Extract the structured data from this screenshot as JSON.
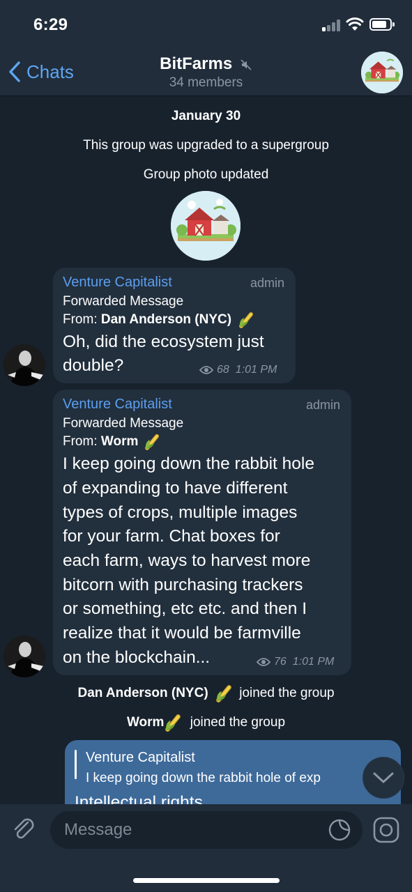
{
  "status_bar": {
    "time": "6:29"
  },
  "header": {
    "back_label": "Chats",
    "title": "BitFarms",
    "subtitle": "34 members"
  },
  "service_messages": {
    "date": "January 30",
    "upgraded": "This group was upgraded to a supergroup",
    "photo_updated": "Group photo updated"
  },
  "messages": [
    {
      "sender": "Venture Capitalist",
      "role": "admin",
      "forward_label": "Forwarded Message",
      "from_prefix": "From: ",
      "from_name": "Dan Anderson (NYC)",
      "lines": [
        "Oh, did the ecosystem just",
        "double?"
      ],
      "views": "68",
      "time": "1:01 PM"
    },
    {
      "sender": "Venture Capitalist",
      "role": "admin",
      "forward_label": "Forwarded Message",
      "from_prefix": "From: ",
      "from_name": "Worm",
      "lines": [
        "I keep going down the rabbit hole",
        "of expanding to have different",
        "types of crops, multiple images",
        "for your farm. Chat boxes for",
        "each farm, ways to harvest more",
        "bitcorn with purchasing trackers",
        "or something, etc etc. and then I",
        "realize that it would be farmville",
        "on the blockchain..."
      ],
      "views": "76",
      "time": "1:01 PM"
    }
  ],
  "joins": [
    {
      "name": "Dan Anderson (NYC)",
      "action": "joined the group"
    },
    {
      "name": "Worm",
      "action": "joined the group"
    }
  ],
  "outgoing": {
    "reply_name": "Venture Capitalist",
    "reply_text": "I keep going down the rabbit hole of exp",
    "text": "Intellectual rights"
  },
  "composer": {
    "placeholder": "Message"
  },
  "colors": {
    "background": "#18222d",
    "bar": "#212d3b",
    "bubble_in": "#222f3d",
    "bubble_out": "#3e6a9a",
    "accent": "#5ea5f1",
    "secondary_text": "#8b96a3"
  },
  "icons": [
    "chevron-left-icon",
    "mute-icon",
    "eye-icon",
    "corn-emoji-icon",
    "paperclip-icon",
    "sticker-icon",
    "camera-icon",
    "chevron-down-icon"
  ]
}
